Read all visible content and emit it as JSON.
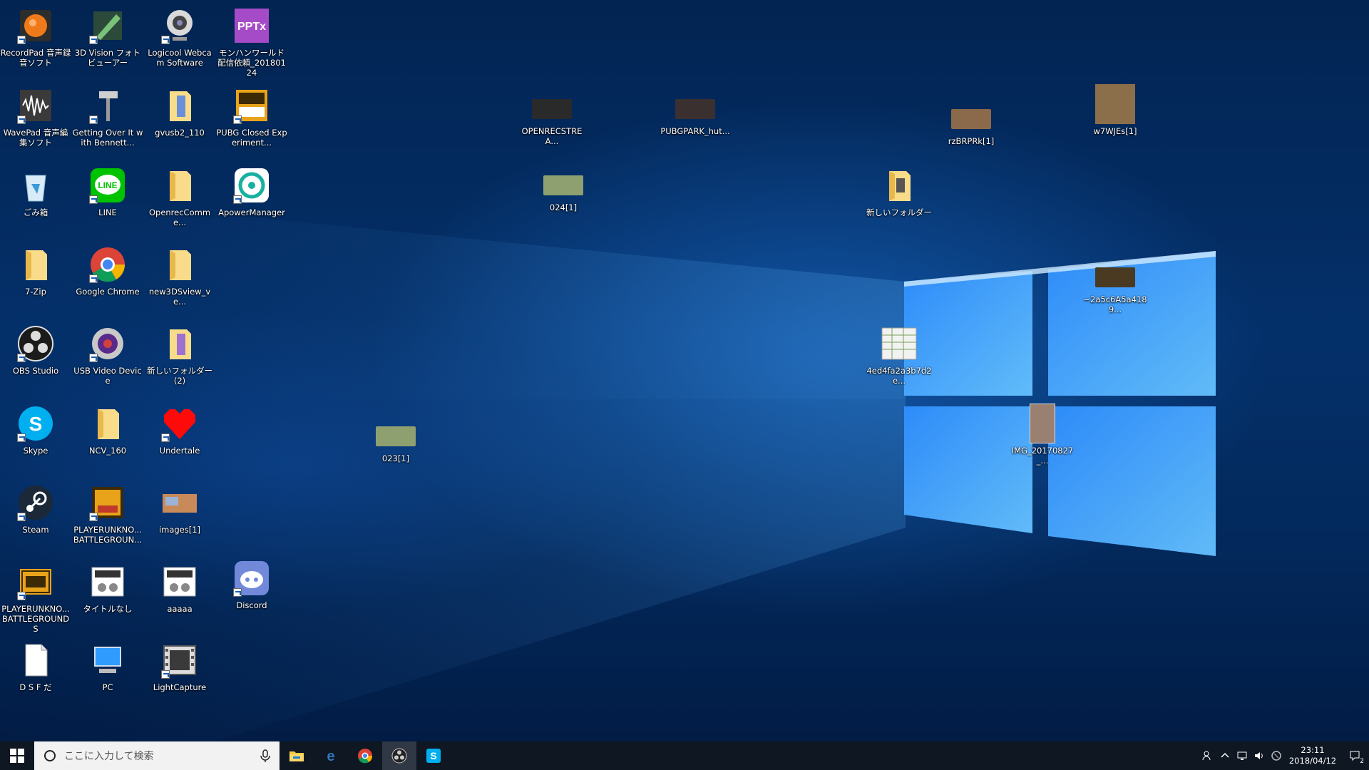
{
  "desktop": {
    "icons": [
      {
        "label": "RecordPad 音声録音ソフト",
        "icon": "recordpad-icon"
      },
      {
        "label": "3D Vision フォト ビューアー",
        "icon": "3d-vision-icon"
      },
      {
        "label": "Logicool Webcam Software",
        "icon": "webcam-icon"
      },
      {
        "label": "モンハンワールド配信依頼_20180124",
        "icon": "pptx-icon"
      },
      {
        "label": "WavePad 音声編集ソフト",
        "icon": "wavepad-icon"
      },
      {
        "label": "Getting Over It with Bennett...",
        "icon": "hammer-icon"
      },
      {
        "label": "gvusb2_110",
        "icon": "folder-zip-icon"
      },
      {
        "label": "PUBG Closed Experiment...",
        "icon": "pubg-ces-icon"
      },
      {
        "label": "ごみ箱",
        "icon": "recycle-bin-icon"
      },
      {
        "label": "LINE",
        "icon": "line-icon"
      },
      {
        "label": "OpenrecComme...",
        "icon": "folder-icon"
      },
      {
        "label": "ApowerManager",
        "icon": "apowermanager-icon"
      },
      {
        "label": "7-Zip",
        "icon": "folder-icon"
      },
      {
        "label": "Google Chrome",
        "icon": "chrome-icon"
      },
      {
        "label": "new3DSview_ve...",
        "icon": "folder-icon"
      },
      {
        "label": "OBS Studio",
        "icon": "obs-icon"
      },
      {
        "label": "USB Video Device",
        "icon": "usb-video-icon"
      },
      {
        "label": "新しいフォルダー (2)",
        "icon": "folder-zip-icon"
      },
      {
        "label": "Skype",
        "icon": "skype-icon"
      },
      {
        "label": "NCV_160",
        "icon": "folder-icon"
      },
      {
        "label": "Undertale",
        "icon": "heart-icon"
      },
      {
        "label": "Steam",
        "icon": "steam-icon"
      },
      {
        "label": "PLAYERUNKNO... BATTLEGROUN...",
        "icon": "pubg-test-icon"
      },
      {
        "label": "images[1]",
        "icon": "image-thumb-icon"
      },
      {
        "label": "PLAYERUNKNO... BATTLEGROUNDS",
        "icon": "pubg-icon"
      },
      {
        "label": "タイトルなし",
        "icon": "image-thumb-icon"
      },
      {
        "label": "aaaaa",
        "icon": "image-thumb-icon"
      },
      {
        "label": "Discord",
        "icon": "discord-icon"
      },
      {
        "label": "D S F だ",
        "icon": "document-icon"
      },
      {
        "label": "PC",
        "icon": "pc-icon"
      },
      {
        "label": "LightCapture",
        "icon": "film-icon"
      },
      {
        "label": "OPENRECSTREA...",
        "icon": "image-thumb-icon"
      },
      {
        "label": "PUBGPARK_hut...",
        "icon": "image-thumb-icon"
      },
      {
        "label": "rzBRPRk[1]",
        "icon": "image-thumb-icon"
      },
      {
        "label": "w7WJEs[1]",
        "icon": "image-thumb-icon"
      },
      {
        "label": "024[1]",
        "icon": "image-thumb-icon"
      },
      {
        "label": "新しいフォルダー",
        "icon": "folder-icon"
      },
      {
        "label": "~2a5c6A5a4189...",
        "icon": "image-thumb-icon"
      },
      {
        "label": "4ed4fa2a3b7d2e...",
        "icon": "image-thumb-icon"
      },
      {
        "label": "023[1]",
        "icon": "image-thumb-icon"
      },
      {
        "label": "IMG_20170827_...",
        "icon": "image-thumb-icon"
      }
    ]
  },
  "taskbar": {
    "search_placeholder": "ここに入力して検索",
    "apps": [
      "file-explorer-icon",
      "edge-icon",
      "chrome-icon",
      "obs-icon",
      "skype-icon"
    ],
    "clock_time": "23:11",
    "clock_date": "2018/04/12",
    "notification_count": "2"
  },
  "colors": {
    "taskbar_bg": "#0f1722",
    "wallpaper_accent": "#3aa0ff"
  }
}
